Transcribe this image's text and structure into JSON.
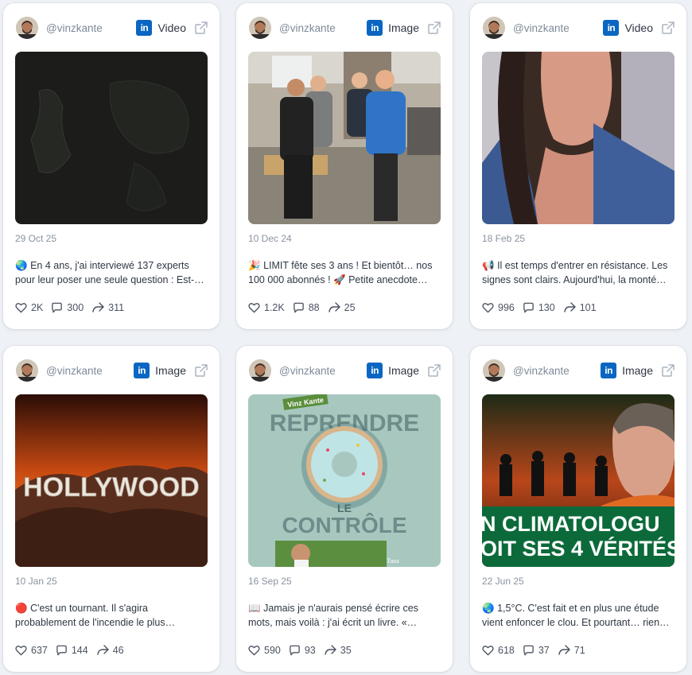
{
  "cards": [
    {
      "handle": "@vinzkante",
      "platform_logo": "in",
      "media_type": "Video",
      "date": "29 Oct 25",
      "emoji": "🌏",
      "text": "En 4 ans, j'ai interviewé 137 experts pour leur poser une seule question : Est-…",
      "likes": "2K",
      "comments": "300",
      "shares": "311",
      "thumb_icon": "dark-map-thumbnail"
    },
    {
      "handle": "@vinzkante",
      "platform_logo": "in",
      "media_type": "Image",
      "date": "10 Dec 24",
      "emoji": "🎉",
      "text": "LIMIT fête ses 3 ans ! Et bientôt… nos 100 000 abonnés ! 🚀 Petite anecdote…",
      "likes": "1.2K",
      "comments": "88",
      "shares": "25",
      "thumb_icon": "team-photo-thumbnail"
    },
    {
      "handle": "@vinzkante",
      "platform_logo": "in",
      "media_type": "Video",
      "date": "18 Feb 25",
      "emoji": "📢",
      "text": "Il est temps d'entrer en résistance. Les signes sont clairs. Aujourd'hui, la monté…",
      "likes": "996",
      "comments": "130",
      "shares": "101",
      "thumb_icon": "woman-portrait-thumbnail"
    },
    {
      "handle": "@vinzkante",
      "platform_logo": "in",
      "media_type": "Image",
      "date": "10 Jan 25",
      "emoji": "🔴",
      "text": "C'est un tournant. Il s'agira probablement de l'incendie le plus…",
      "likes": "637",
      "comments": "144",
      "shares": "46",
      "thumb_icon": "hollywood-fire-thumbnail",
      "thumb_text": "HOLLYWOOD"
    },
    {
      "handle": "@vinzkante",
      "platform_logo": "in",
      "media_type": "Image",
      "date": "16 Sep 25",
      "emoji": "📖",
      "text": "Jamais je n'aurais pensé écrire ces mots, mais voilà : j'ai écrit un livre. «…",
      "likes": "590",
      "comments": "93",
      "shares": "35",
      "thumb_icon": "book-cover-thumbnail",
      "thumb_text_top": "Vinz Kante",
      "thumb_text_main": "REPRENDRE",
      "thumb_text_le": "LE",
      "thumb_text_bottom": "CONTRÔLE",
      "thumb_text_publisher": "Tana"
    },
    {
      "handle": "@vinzkante",
      "platform_logo": "in",
      "media_type": "Image",
      "date": "22 Jun 25",
      "emoji": "🌏",
      "text": "1,5°C. C'est fait et en plus une étude vient enfoncer le clou. Et pourtant… rien…",
      "likes": "618",
      "comments": "37",
      "shares": "71",
      "thumb_icon": "climatologue-thumbnail",
      "thumb_text_line1": "N CLIMATOLOGU",
      "thumb_text_line2": "OIT SES 4 VÉRITÉS"
    }
  ],
  "colors": {
    "linkedin": "#0a66c2",
    "page_bg": "#eef1f6",
    "card_bg": "#ffffff"
  }
}
